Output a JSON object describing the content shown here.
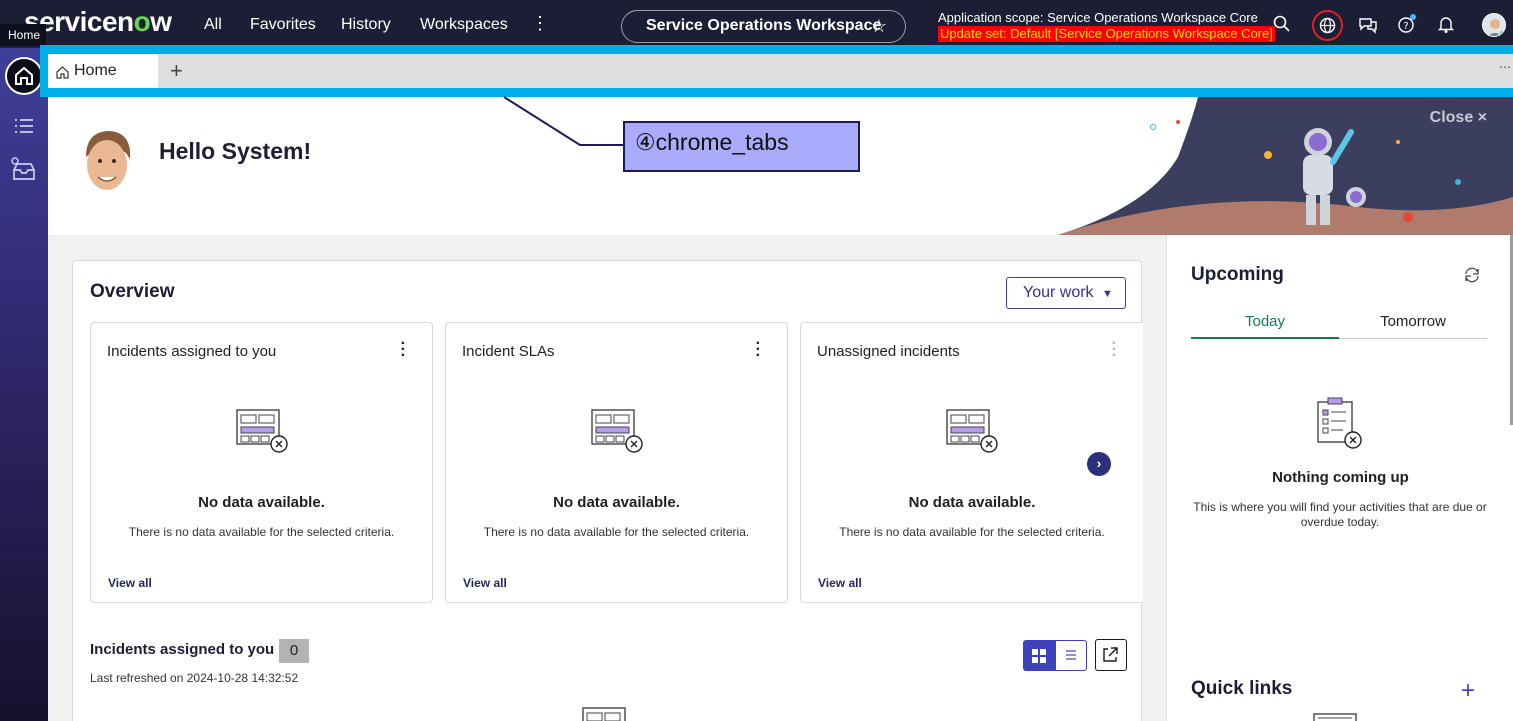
{
  "topnav": {
    "logo": "servicenow",
    "home_tooltip": "Home",
    "links": [
      "All",
      "Favorites",
      "History",
      "Workspaces"
    ],
    "more": "⋮",
    "workspace_title": "Service Operations Workspace",
    "star": "☆",
    "scope_line": "Application scope: Service Operations Workspace Core",
    "update_set": "Update set: Default [Service Operations Workspace Core]",
    "icons": [
      "search-icon",
      "globe-icon",
      "chat-icon",
      "help-icon",
      "bell-icon",
      "user-avatar"
    ]
  },
  "sidebar": {
    "items": [
      "home-icon",
      "list-icon",
      "inbox-icon"
    ]
  },
  "chrome_tabs": {
    "tabs": [
      {
        "label": "Home"
      }
    ],
    "add": "+",
    "more": "⋯"
  },
  "hero": {
    "greeting": "Hello System!",
    "close": "Close ×"
  },
  "annotation": {
    "label": "④chrome_tabs"
  },
  "overview": {
    "title": "Overview",
    "filter": "Your work",
    "cards": [
      {
        "title": "Incidents assigned to you",
        "empty_title": "No data available.",
        "empty_desc": "There is no data available for the selected criteria.",
        "view_all": "View all"
      },
      {
        "title": "Incident SLAs",
        "empty_title": "No data available.",
        "empty_desc": "There is no data available for the selected criteria.",
        "view_all": "View all"
      },
      {
        "title": "Unassigned incidents",
        "empty_title": "No data available.",
        "empty_desc": "There is no data available for the selected criteria.",
        "view_all": "View all"
      }
    ],
    "incidents": {
      "title": "Incidents assigned to you",
      "count": "0",
      "last_refreshed": "Last refreshed on 2024-10-28 14:32:52"
    }
  },
  "upcoming": {
    "title": "Upcoming",
    "tabs": [
      "Today",
      "Tomorrow"
    ],
    "empty_title": "Nothing coming up",
    "empty_desc": "This is where you will find your activities that are due or overdue today.",
    "quick_links_title": "Quick links",
    "quick_links_add": "+"
  },
  "colors": {
    "nav_bg": "#1b1e35",
    "accent": "#3e43bd",
    "tab_highlight": "#00aee9",
    "update_set_bg": "#ff0000",
    "update_set_text": "#ffdf00",
    "today_green": "#157a5a"
  }
}
